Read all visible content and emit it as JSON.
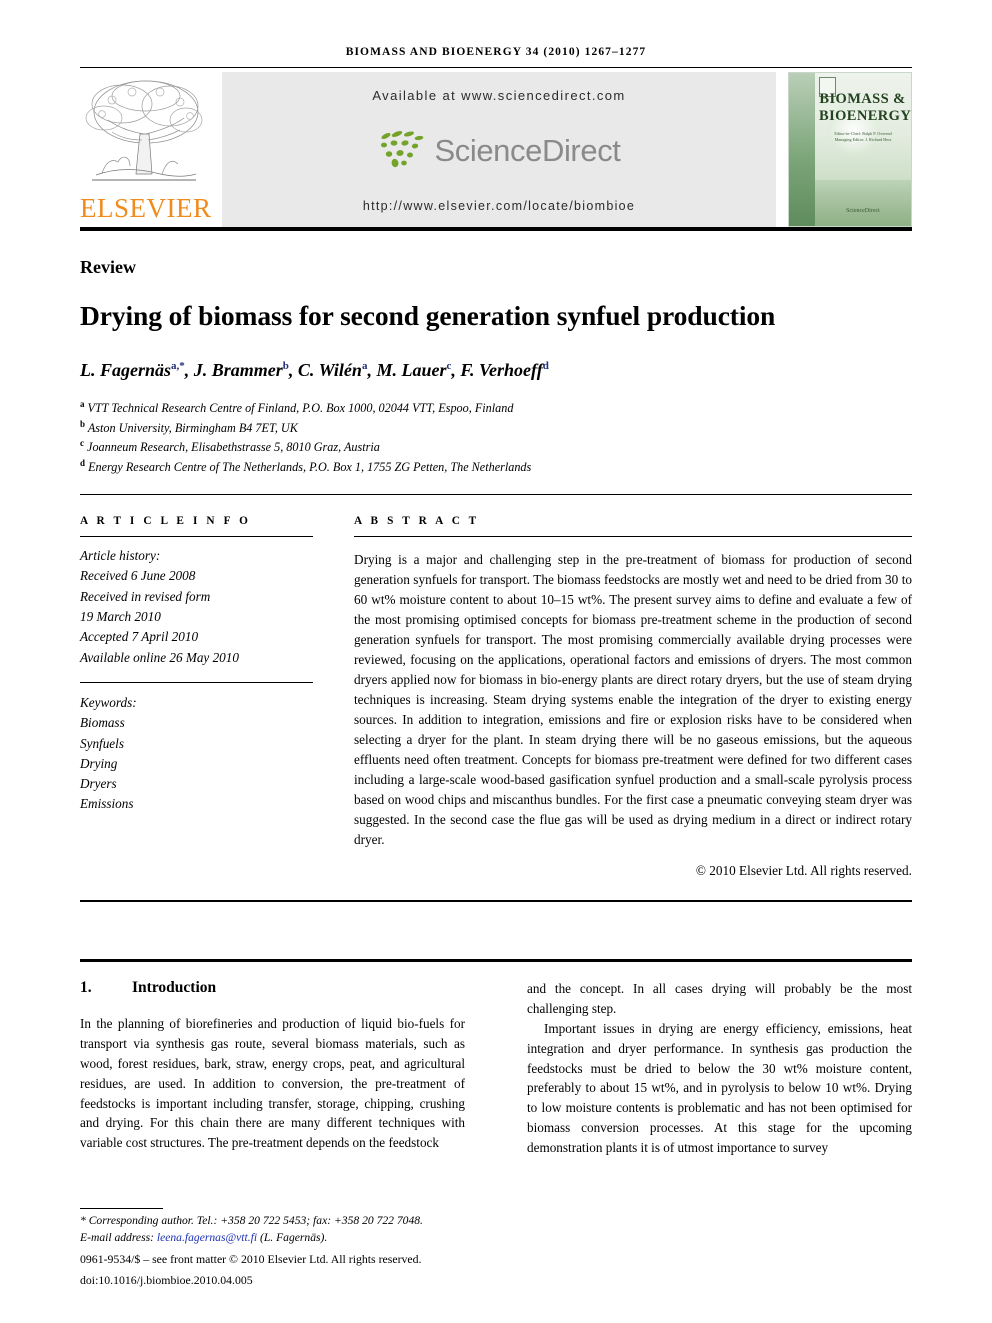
{
  "running_head": "BIOMASS AND BIOENERGY 34 (2010) 1267–1277",
  "masthead": {
    "publisher_name": "ELSEVIER",
    "available_at": "Available at www.sciencedirect.com",
    "sciencedirect_wordmark": "ScienceDirect",
    "journal_url": "http://www.elsevier.com/locate/biombioe",
    "cover": {
      "title_line1": "BIOMASS &",
      "title_line2": "BIOENERGY",
      "editors_line1": "Editor-in-Chief: Ralph P. Overend",
      "editors_line2": "Managing Editor: J. Richard Hess",
      "imprint": "ScienceDirect"
    }
  },
  "article": {
    "type_label": "Review",
    "title": "Drying of biomass for second generation synfuel production",
    "authors": [
      {
        "name": "L. Fagernäs",
        "marks": "a,*"
      },
      {
        "name": "J. Brammer",
        "marks": "b"
      },
      {
        "name": "C. Wilén",
        "marks": "a"
      },
      {
        "name": "M. Lauer",
        "marks": "c"
      },
      {
        "name": "F. Verhoeff",
        "marks": "d"
      }
    ],
    "affiliations": [
      {
        "mark": "a",
        "text": "VTT Technical Research Centre of Finland, P.O. Box 1000, 02044 VTT, Espoo, Finland"
      },
      {
        "mark": "b",
        "text": "Aston University, Birmingham B4 7ET, UK"
      },
      {
        "mark": "c",
        "text": "Joanneum Research, Elisabethstrasse 5, 8010 Graz, Austria"
      },
      {
        "mark": "d",
        "text": "Energy Research Centre of The Netherlands, P.O. Box 1, 1755 ZG Petten, The Netherlands"
      }
    ]
  },
  "article_info": {
    "heading": "A R T I C L E    I N F O",
    "history_label": "Article history:",
    "history": [
      "Received 6 June 2008",
      "Received in revised form",
      "19 March 2010",
      "Accepted 7 April 2010",
      "Available online 26 May 2010"
    ],
    "keywords_label": "Keywords:",
    "keywords": [
      "Biomass",
      "Synfuels",
      "Drying",
      "Dryers",
      "Emissions"
    ]
  },
  "abstract": {
    "heading": "A B S T R A C T",
    "text": "Drying is a major and challenging step in the pre-treatment of biomass for production of second generation synfuels for transport. The biomass feedstocks are mostly wet and need to be dried from 30 to 60 wt% moisture content to about 10–15 wt%. The present survey aims to define and evaluate a few of the most promising optimised concepts for biomass pre-treatment scheme in the production of second generation synfuels for transport. The most promising commercially available drying processes were reviewed, focusing on the applications, operational factors and emissions of dryers. The most common dryers applied now for biomass in bio-energy plants are direct rotary dryers, but the use of steam drying techniques is increasing. Steam drying systems enable the integration of the dryer to existing energy sources. In addition to integration, emissions and fire or explosion risks have to be considered when selecting a dryer for the plant. In steam drying there will be no gaseous emissions, but the aqueous effluents need often treatment. Concepts for biomass pre-treatment were defined for two different cases including a large-scale wood-based gasification synfuel production and a small-scale pyrolysis process based on wood chips and miscanthus bundles. For the first case a pneumatic conveying steam dryer was suggested. In the second case the flue gas will be used as drying medium in a direct or indirect rotary dryer.",
    "copyright": "© 2010 Elsevier Ltd. All rights reserved."
  },
  "body": {
    "section_number": "1.",
    "section_title": "Introduction",
    "left_paragraph": "In the planning of biorefineries and production of liquid bio-fuels for transport via synthesis gas route, several biomass materials, such as wood, forest residues, bark, straw, energy crops, peat, and agricultural residues, are used. In addition to conversion, the pre-treatment of feedstocks is important including transfer, storage, chipping, crushing and drying. For this chain there are many different techniques with variable cost structures. The pre-treatment depends on the feedstock",
    "right_paragraph_1": "and the concept. In all cases drying will probably be the most challenging step.",
    "right_paragraph_2": "Important issues in drying are energy efficiency, emissions, heat integration and dryer performance. In synthesis gas production the feedstocks must be dried to below the 30 wt% moisture content, preferably to about 15 wt%, and in pyrolysis to below 10 wt%. Drying to low moisture contents is problematic and has not been optimised for biomass conversion processes. At this stage for the upcoming demonstration plants it is of utmost importance to survey"
  },
  "footer": {
    "corresponding_note": "* Corresponding author. Tel.: +358 20 722 5453; fax: +358 20 722 7048.",
    "email_label": "E-mail address:",
    "email": "leena.fagernas@vtt.fi",
    "email_suffix": "(L. Fagernäs).",
    "issn_line": "0961-9534/$ – see front matter © 2010 Elsevier Ltd. All rights reserved.",
    "doi_line": "doi:10.1016/j.biombioe.2010.04.005"
  },
  "colors": {
    "elsevier_orange": "#F08C1E",
    "sciencedirect_green": "#74A32A",
    "sciencedirect_gray": "#8a8a8a",
    "band_gray": "#e9e9e9",
    "link_blue": "#1a2fb5",
    "cover_green": "#7da67a"
  }
}
